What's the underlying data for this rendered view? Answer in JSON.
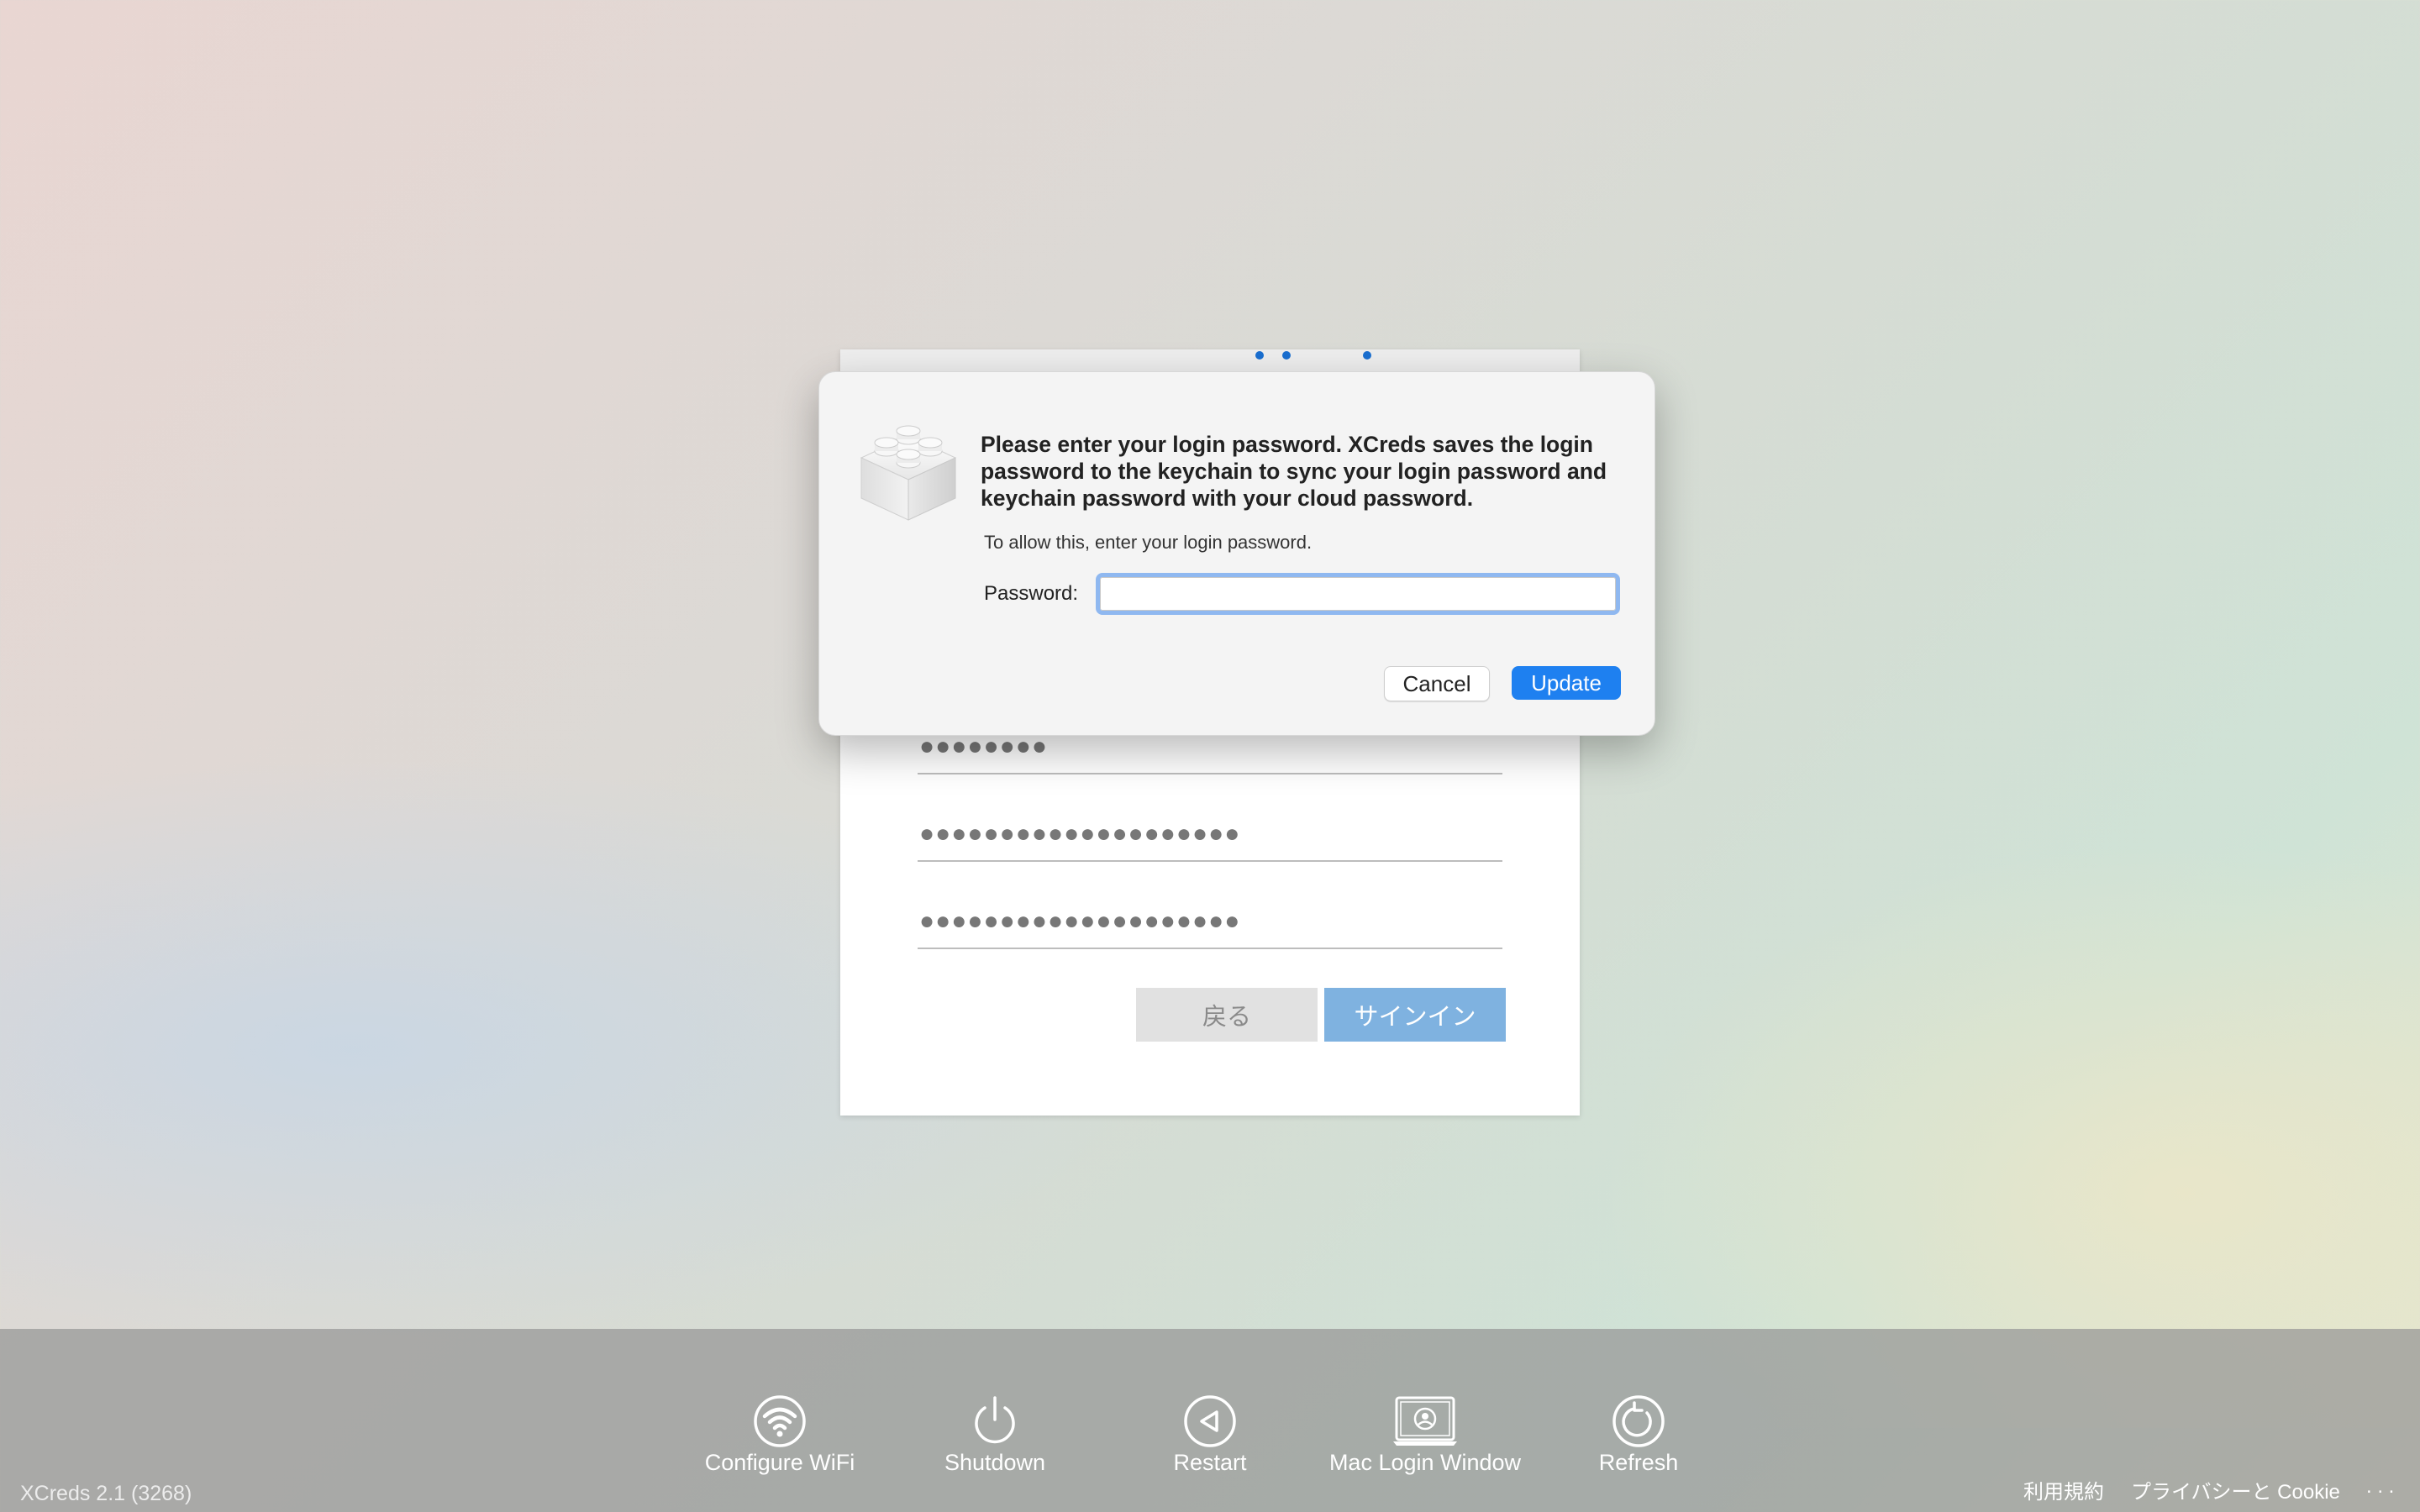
{
  "web_form": {
    "field1_masked": "●●●●●●●●",
    "field2_masked": "●●●●●●●●●●●●●●●●●●●●",
    "field3_masked": "●●●●●●●●●●●●●●●●●●●●",
    "back_label": "戻る",
    "signin_label": "サインイン"
  },
  "dialog": {
    "icon": "lego-brick-icon",
    "title": "Please enter your login password. XCreds saves the login password to the keychain to sync your login password and keychain password with your cloud password.",
    "subtitle": "To allow this, enter your login password.",
    "password_label": "Password:",
    "password_value": "",
    "cancel_label": "Cancel",
    "update_label": "Update",
    "accent_color": "#1e80f0"
  },
  "toolbar": {
    "items": [
      {
        "label": "Configure WiFi",
        "icon": "wifi-icon"
      },
      {
        "label": "Shutdown",
        "icon": "power-icon"
      },
      {
        "label": "Restart",
        "icon": "restart-icon"
      },
      {
        "label": "Mac Login Window",
        "icon": "login-window-icon"
      },
      {
        "label": "Refresh",
        "icon": "refresh-icon"
      }
    ],
    "version": "XCreds 2.1 (3268)",
    "links": [
      {
        "label": "利用規約"
      },
      {
        "label": "プライバシーと Cookie"
      },
      {
        "label": ". . ."
      }
    ]
  }
}
